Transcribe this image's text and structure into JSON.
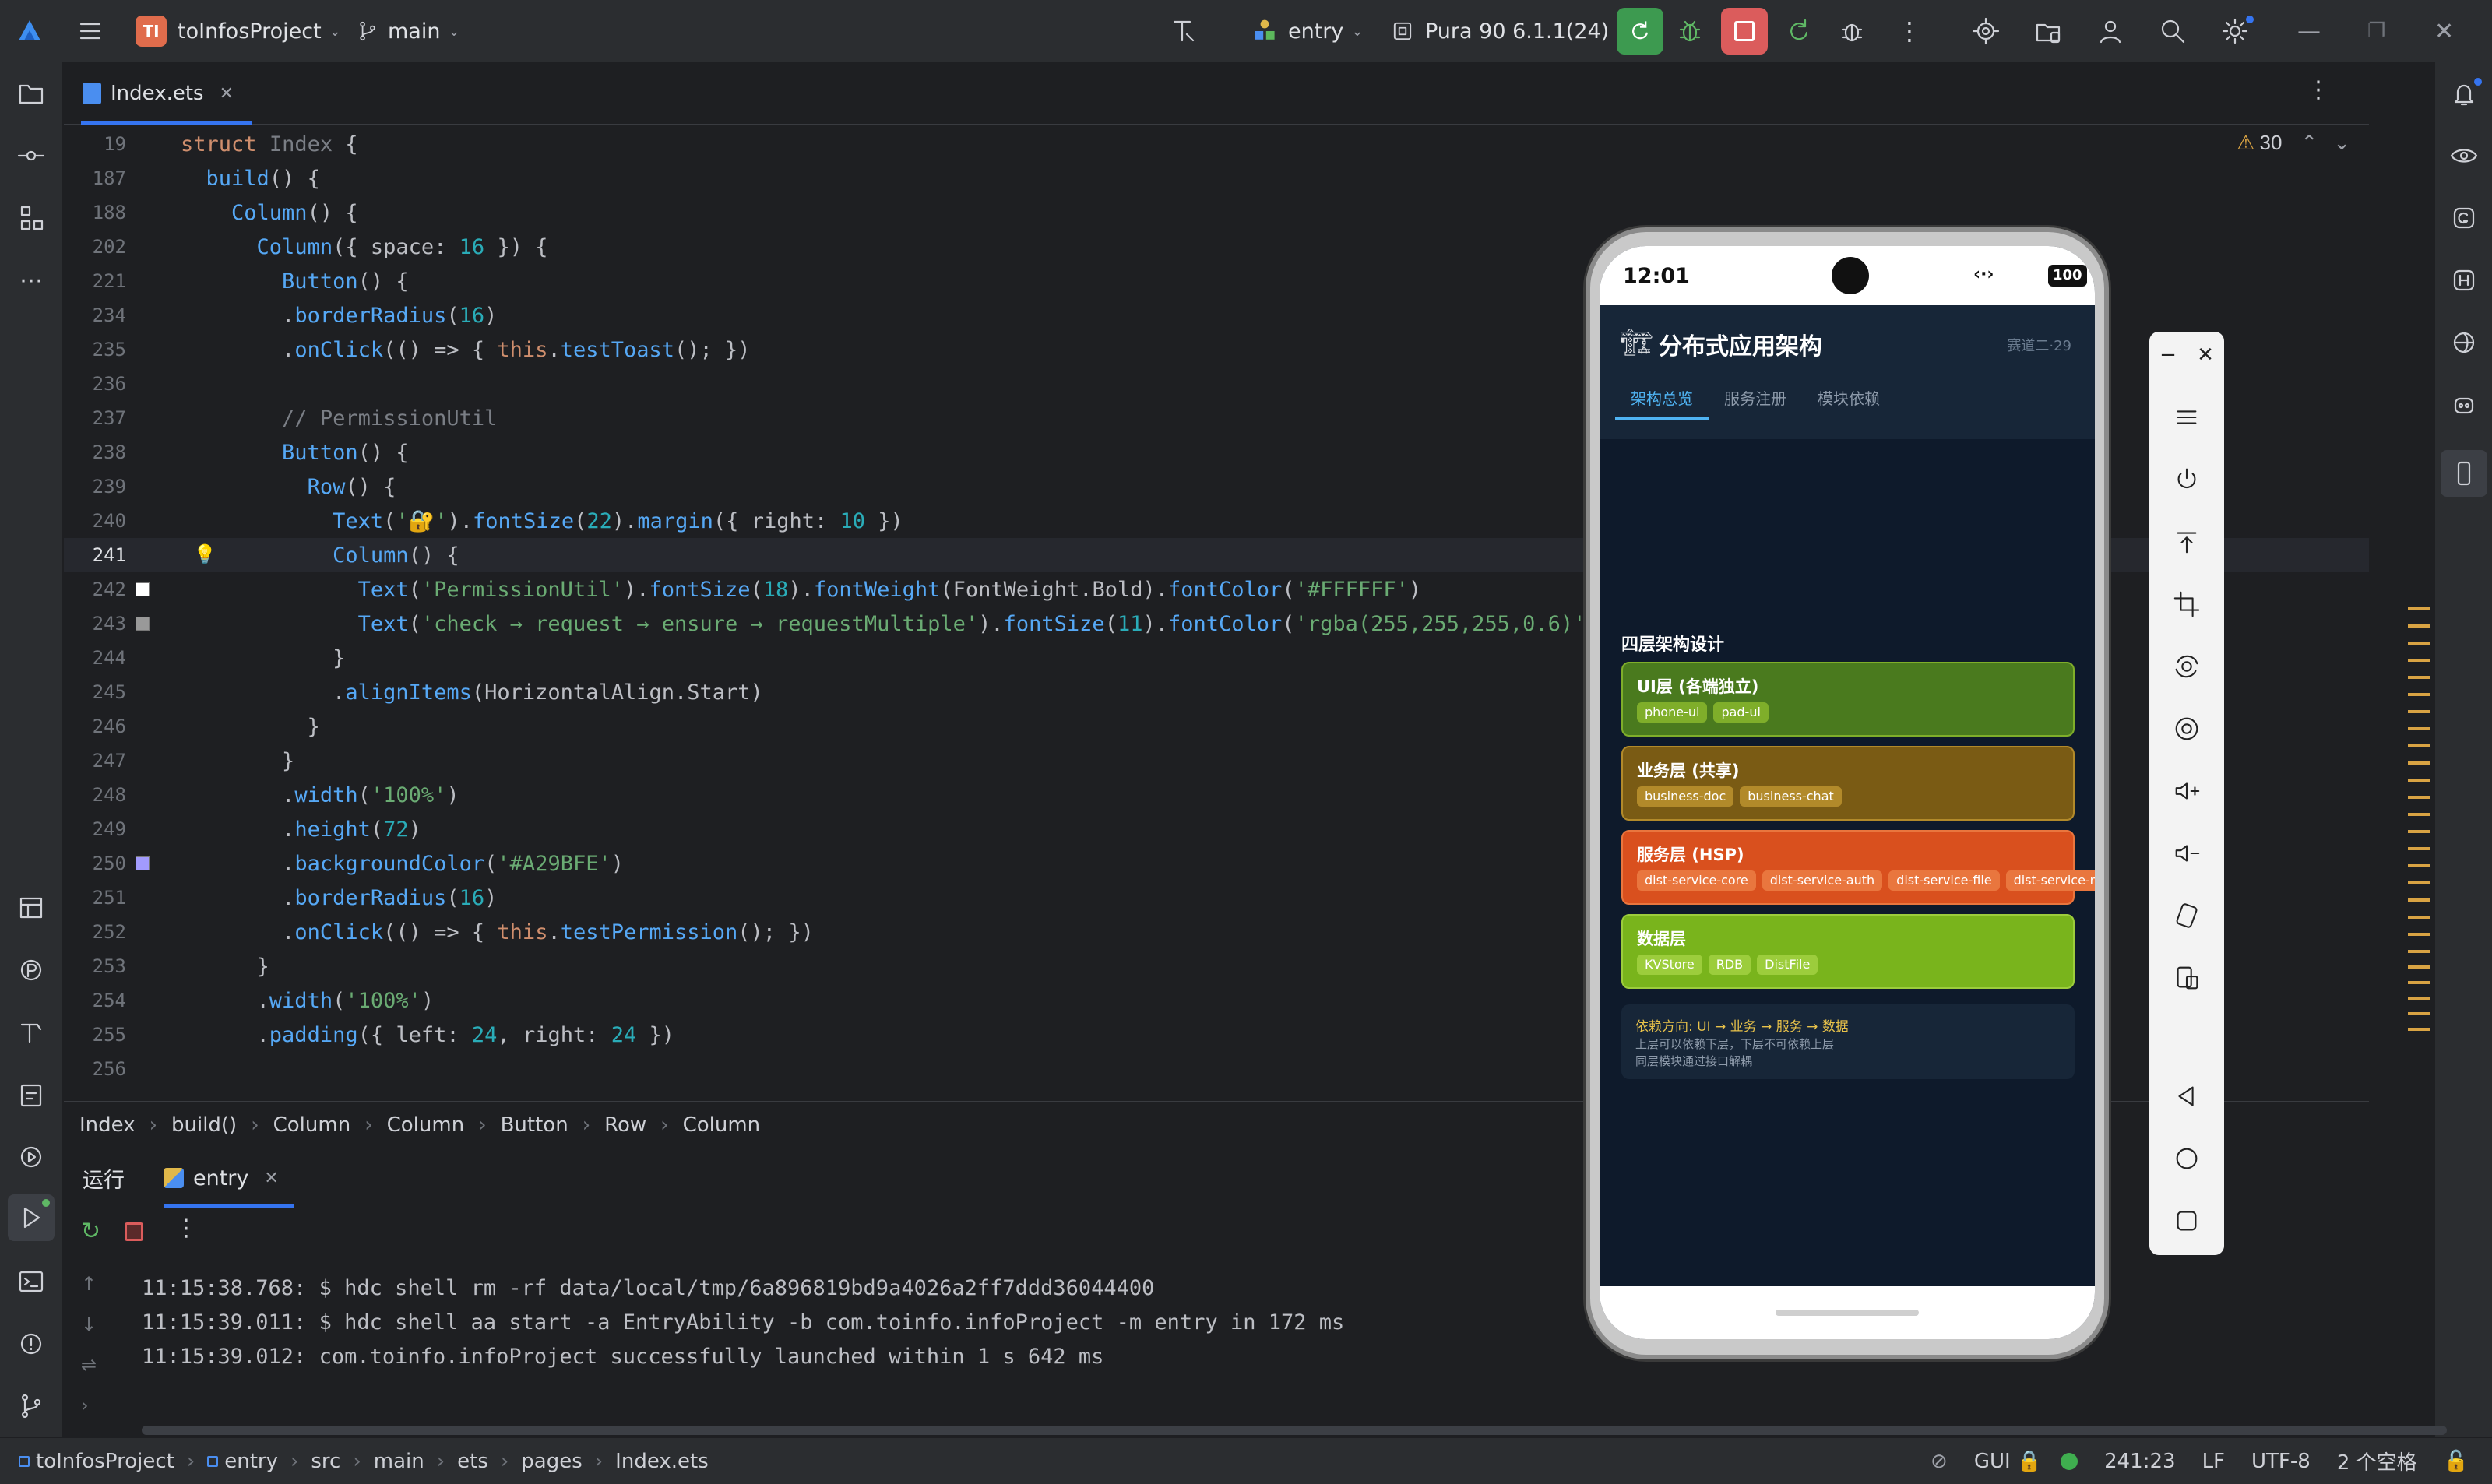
{
  "titlebar": {
    "project_badge": "TI",
    "project_name": "toInfosProject",
    "branch": "main",
    "run_config": "entry",
    "device": "Pura 90 6.1.1(24)"
  },
  "editor": {
    "tab_label": "Index.ets",
    "warning_count": "30",
    "lines": [
      {
        "no": "19",
        "html": "<span class='kw'>struct</span> <span class='cm'>Index</span> {"
      },
      {
        "no": "187",
        "html": "  <span class='fn'>build</span>() {"
      },
      {
        "no": "188",
        "html": "    <span class='fn'>Column</span>() {"
      },
      {
        "no": "202",
        "html": "      <span class='fn'>Column</span>({ <span class='ty'>space</span>: <span class='num'>16</span> }) {"
      },
      {
        "no": "221",
        "html": "        <span class='fn'>Button</span>() {"
      },
      {
        "no": "234",
        "html": "        .<span class='fn'>borderRadius</span>(<span class='num'>16</span>)"
      },
      {
        "no": "235",
        "html": "        .<span class='fn'>onClick</span>(() => { <span class='kw'>this</span>.<span class='fn'>testToast</span>(); })"
      },
      {
        "no": "236",
        "html": ""
      },
      {
        "no": "237",
        "html": "        <span class='cm'>// PermissionUtil</span>"
      },
      {
        "no": "238",
        "html": "        <span class='fn'>Button</span>() {"
      },
      {
        "no": "239",
        "html": "          <span class='fn'>Row</span>() {"
      },
      {
        "no": "240",
        "html": "            <span class='fn'>Text</span>(<span class='str'>'🔐'</span>).<span class='fn'>fontSize</span>(<span class='num'>22</span>).<span class='fn'>margin</span>({ <span class='ty'>right</span>: <span class='num'>10</span> })"
      },
      {
        "no": "241",
        "html": "            <span class='fn'>Column</span>() {"
      },
      {
        "no": "242",
        "html": "              <span class='fn'>Text</span>(<span class='str'>'PermissionUtil'</span>).<span class='fn'>fontSize</span>(<span class='num'>18</span>).<span class='fn'>fontWeight</span>(FontWeight.<span class='ty'>Bold</span>).<span class='fn'>fontColor</span>(<span class='str'>'#FFFFFF'</span>)"
      },
      {
        "no": "243",
        "html": "              <span class='fn'>Text</span>(<span class='str'>'check → request → ensure → requestMultiple'</span>).<span class='fn'>fontSize</span>(<span class='num'>11</span>).<span class='fn'>fontColor</span>(<span class='str'>'rgba(255,255,255,0.6)'</span>)"
      },
      {
        "no": "244",
        "html": "            }"
      },
      {
        "no": "245",
        "html": "            .<span class='fn'>alignItems</span>(HorizontalAlign.<span class='ty'>Start</span>)"
      },
      {
        "no": "246",
        "html": "          }"
      },
      {
        "no": "247",
        "html": "        }"
      },
      {
        "no": "248",
        "html": "        .<span class='fn'>width</span>(<span class='str'>'100%'</span>)"
      },
      {
        "no": "249",
        "html": "        .<span class='fn'>height</span>(<span class='num'>72</span>)"
      },
      {
        "no": "250",
        "html": "        .<span class='fn'>backgroundColor</span>(<span class='str'>'#A29BFE'</span>)"
      },
      {
        "no": "251",
        "html": "        .<span class='fn'>borderRadius</span>(<span class='num'>16</span>)"
      },
      {
        "no": "252",
        "html": "        .<span class='fn'>onClick</span>(() => { <span class='kw'>this</span>.<span class='fn'>testPermission</span>(); })"
      },
      {
        "no": "253",
        "html": "      }"
      },
      {
        "no": "254",
        "html": "      .<span class='fn'>width</span>(<span class='str'>'100%'</span>)"
      },
      {
        "no": "255",
        "html": "      .<span class='fn'>padding</span>({ <span class='ty'>left</span>: <span class='num'>24</span>, <span class='ty'>right</span>: <span class='num'>24</span> })"
      },
      {
        "no": "256",
        "html": ""
      }
    ]
  },
  "breadcrumb": [
    "Index",
    "build()",
    "Column",
    "Column",
    "Button",
    "Row",
    "Column"
  ],
  "runpanel": {
    "run_tab": "运行",
    "entry_tab": "entry",
    "console": [
      "11:15:38.768: $ hdc shell rm -rf data/local/tmp/6a896819bd9a4026a2ff7ddd36044400",
      "11:15:39.011: $ hdc shell aa start -a EntryAbility -b com.toinfo.infoProject -m entry in 172 ms",
      "11:15:39.012: com.toinfo.infoProject successfully launched within 1 s 642 ms"
    ]
  },
  "statusbar": {
    "path": [
      "toInfosProject",
      "entry",
      "src",
      "main",
      "ets",
      "pages",
      "Index.ets"
    ],
    "gui": "GUI",
    "position": "241:23",
    "line_sep": "LF",
    "encoding": "UTF-8",
    "indent": "2 个空格"
  },
  "phone": {
    "time": "12:01",
    "battery": "100",
    "app_title": "分布式应用架构",
    "app_meta": "赛道二·29",
    "tabs": [
      "架构总览",
      "服务注册",
      "模块依赖"
    ],
    "section_title": "四层架构设计",
    "layers": [
      {
        "title": "UI层 (各端独立)",
        "bg": "#4a7a1e",
        "chipbg": "#7fae2a",
        "chips": [
          "phone-ui",
          "pad-ui"
        ]
      },
      {
        "title": "业务层 (共享)",
        "bg": "#7a5b14",
        "chipbg": "#b28a2a",
        "chips": [
          "business-doc",
          "business-chat"
        ]
      },
      {
        "title": "服务层 (HSP)",
        "bg": "#d9501e",
        "chipbg": "#e9763e",
        "chips": [
          "dist-service-core",
          "dist-service-auth",
          "dist-service-file",
          "dist-service-media"
        ]
      },
      {
        "title": "数据层",
        "bg": "#79b41c",
        "chipbg": "#9ccd3c",
        "chips": [
          "KVStore",
          "RDB",
          "DistFile"
        ]
      }
    ],
    "note_title": "依赖方向: UI → 业务 → 服务 → 数据",
    "note_line1": "上层可以依赖下层，下层不可依赖上层",
    "note_line2": "同层模块通过接口解耦"
  },
  "colors": {
    "accent": "#3574f0",
    "run_green": "#3d9a50",
    "stop_red": "#db5c5c",
    "warning": "#d9a343"
  }
}
